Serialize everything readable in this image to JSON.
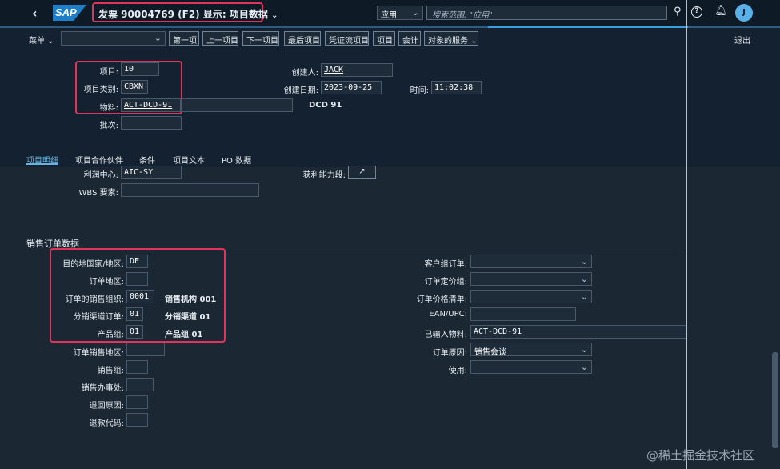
{
  "shell": {
    "title": "发票 90004769 (F2) 显示: 项目数据",
    "logo": "SAP",
    "scope_select": "应用",
    "search_placeholder": "搜索范围: \"应用\"",
    "avatar_initial": "J"
  },
  "toolbar": {
    "menu_label": "菜单",
    "buttons": [
      "第一项",
      "上一项目",
      "下一项目",
      "最后项目",
      "凭证流项目",
      "项目",
      "会计",
      "对象的服务"
    ],
    "exit_label": "退出"
  },
  "header": {
    "item_label": "项目:",
    "item_value": "10",
    "category_label": "项目类别:",
    "category_value": "CBXN",
    "material_label": "物料:",
    "material_value": "ACT-DCD-91",
    "material_desc": "DCD 91",
    "batch_label": "批次:",
    "creator_label": "创建人:",
    "creator_value": "JACK",
    "created_on_label": "创建日期:",
    "created_on_value": "2023-09-25",
    "time_label": "时间:",
    "time_value": "11:02:38"
  },
  "tabs": [
    "项目明细",
    "项目合作伙伴",
    "条件",
    "项目文本",
    "PO 数据"
  ],
  "active_tab": "项目明细",
  "detail": {
    "profit_center_label": "利润中心:",
    "profit_center_value": "AIC-SY",
    "profitability_label": "获利能力段:",
    "wbs_label": "WBS 要素:"
  },
  "sales_order": {
    "section_title": "销售订单数据",
    "dest_country_label": "目的地国家/地区:",
    "dest_country_value": "DE",
    "order_region_label": "订单地区:",
    "sales_org_label": "订单的销售组织:",
    "sales_org_value": "0001",
    "sales_org_desc": "销售机构 001",
    "dist_channel_label": "分销渠道订单:",
    "dist_channel_value": "01",
    "dist_channel_desc": "分销渠道 01",
    "division_label": "产品组:",
    "division_value": "01",
    "division_desc": "产品组 01",
    "sales_district_label": "订单销售地区:",
    "sales_group_label": "销售组:",
    "sales_office_label": "销售办事处:",
    "return_reason_label": "退回原因:",
    "refund_code_label": "退款代码:",
    "customer_group_label": "客户组订单:",
    "price_group_label": "订单定价组:",
    "price_list_label": "订单价格清单:",
    "ean_label": "EAN/UPC:",
    "entered_material_label": "已输入物料:",
    "entered_material_value": "ACT-DCD-91",
    "order_reason_label": "订单原因:",
    "order_reason_value": "销售会谈",
    "usage_label": "使用:"
  },
  "watermark": "@稀土掘金技术社区"
}
